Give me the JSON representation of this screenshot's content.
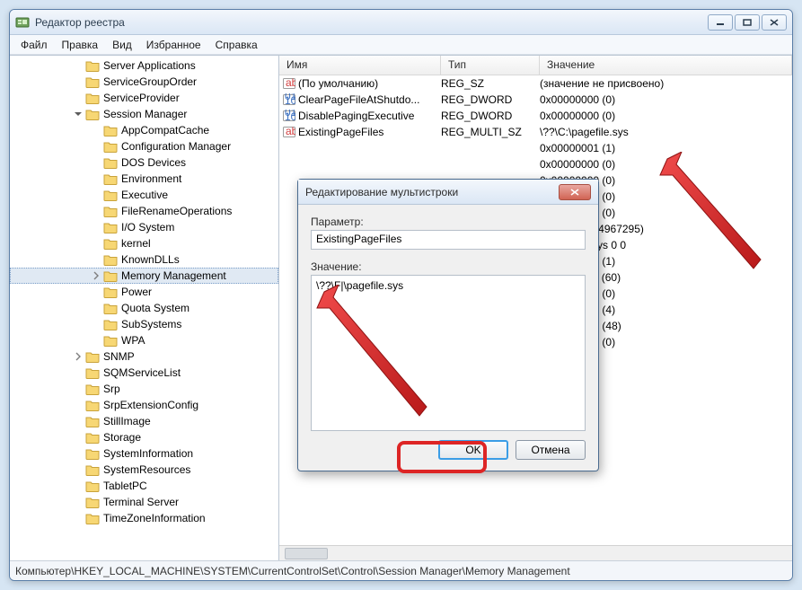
{
  "title": "Редактор реестра",
  "menu": [
    "Файл",
    "Правка",
    "Вид",
    "Избранное",
    "Справка"
  ],
  "tree": [
    {
      "level": 3,
      "exp": null,
      "label": "Server Applications"
    },
    {
      "level": 3,
      "exp": null,
      "label": "ServiceGroupOrder"
    },
    {
      "level": 3,
      "exp": null,
      "label": "ServiceProvider"
    },
    {
      "level": 3,
      "exp": "open",
      "label": "Session Manager"
    },
    {
      "level": 4,
      "exp": null,
      "label": "AppCompatCache"
    },
    {
      "level": 4,
      "exp": null,
      "label": "Configuration Manager"
    },
    {
      "level": 4,
      "exp": null,
      "label": "DOS Devices"
    },
    {
      "level": 4,
      "exp": null,
      "label": "Environment"
    },
    {
      "level": 4,
      "exp": null,
      "label": "Executive"
    },
    {
      "level": 4,
      "exp": null,
      "label": "FileRenameOperations"
    },
    {
      "level": 4,
      "exp": null,
      "label": "I/O System"
    },
    {
      "level": 4,
      "exp": null,
      "label": "kernel"
    },
    {
      "level": 4,
      "exp": null,
      "label": "KnownDLLs"
    },
    {
      "level": 4,
      "exp": "closed",
      "label": "Memory Management",
      "selected": true
    },
    {
      "level": 4,
      "exp": null,
      "label": "Power"
    },
    {
      "level": 4,
      "exp": null,
      "label": "Quota System"
    },
    {
      "level": 4,
      "exp": null,
      "label": "SubSystems"
    },
    {
      "level": 4,
      "exp": null,
      "label": "WPA"
    },
    {
      "level": 3,
      "exp": "closed",
      "label": "SNMP"
    },
    {
      "level": 3,
      "exp": null,
      "label": "SQMServiceList"
    },
    {
      "level": 3,
      "exp": null,
      "label": "Srp"
    },
    {
      "level": 3,
      "exp": null,
      "label": "SrpExtensionConfig"
    },
    {
      "level": 3,
      "exp": null,
      "label": "StillImage"
    },
    {
      "level": 3,
      "exp": null,
      "label": "Storage"
    },
    {
      "level": 3,
      "exp": null,
      "label": "SystemInformation"
    },
    {
      "level": 3,
      "exp": null,
      "label": "SystemResources"
    },
    {
      "level": 3,
      "exp": null,
      "label": "TabletPC"
    },
    {
      "level": 3,
      "exp": null,
      "label": "Terminal Server"
    },
    {
      "level": 3,
      "exp": null,
      "label": "TimeZoneInformation"
    }
  ],
  "cols": {
    "name": "Имя",
    "type": "Тип",
    "data": "Значение"
  },
  "values": [
    {
      "icon": "ab",
      "name": "(По умолчанию)",
      "type": "REG_SZ",
      "data": "(значение не присвоено)"
    },
    {
      "icon": "bin",
      "name": "ClearPageFileAtShutdo...",
      "type": "REG_DWORD",
      "data": "0x00000000 (0)"
    },
    {
      "icon": "bin",
      "name": "DisablePagingExecutive",
      "type": "REG_DWORD",
      "data": "0x00000000 (0)"
    },
    {
      "icon": "ab",
      "name": "ExistingPageFiles",
      "type": "REG_MULTI_SZ",
      "data": "\\??\\C:\\pagefile.sys"
    },
    {
      "icon": "",
      "name": "",
      "type": "",
      "data": "0x00000001 (1)"
    },
    {
      "icon": "",
      "name": "",
      "type": "",
      "data": "0x00000000 (0)"
    },
    {
      "icon": "",
      "name": "",
      "type": "",
      "data": "0x00000000 (0)"
    },
    {
      "icon": "",
      "name": "",
      "type": "",
      "data": "0x00000000 (0)"
    },
    {
      "icon": "",
      "name": "",
      "type": "",
      "data": "0x00000000 (0)"
    },
    {
      "icon": "",
      "name": "",
      "type": "",
      "data": "0xffffffff (4294967295)"
    },
    {
      "icon": "",
      "name": "",
      "type": "",
      "data": "c:\\pagefile.sys 0 0"
    },
    {
      "icon": "",
      "name": "",
      "type": "",
      "data": "0x00000001 (1)"
    },
    {
      "icon": "",
      "name": "",
      "type": "",
      "data": "0x0000003c (60)"
    },
    {
      "icon": "",
      "name": "",
      "type": "",
      "data": "0x00000000 (0)"
    },
    {
      "icon": "",
      "name": "",
      "type": "",
      "data": "0x00000004 (4)"
    },
    {
      "icon": "",
      "name": "",
      "type": "",
      "data": "0x00000030 (48)"
    },
    {
      "icon": "",
      "name": "",
      "type": "",
      "data": "0x00000000 (0)"
    }
  ],
  "status": "Компьютер\\HKEY_LOCAL_MACHINE\\SYSTEM\\CurrentControlSet\\Control\\Session Manager\\Memory Management",
  "dialog": {
    "title": "Редактирование мультистроки",
    "param_label": "Параметр:",
    "param_value": "ExistingPageFiles",
    "value_label": "Значение:",
    "value_text": "\\??\\F|\\pagefile.sys",
    "ok": "OK",
    "cancel": "Отмена"
  }
}
